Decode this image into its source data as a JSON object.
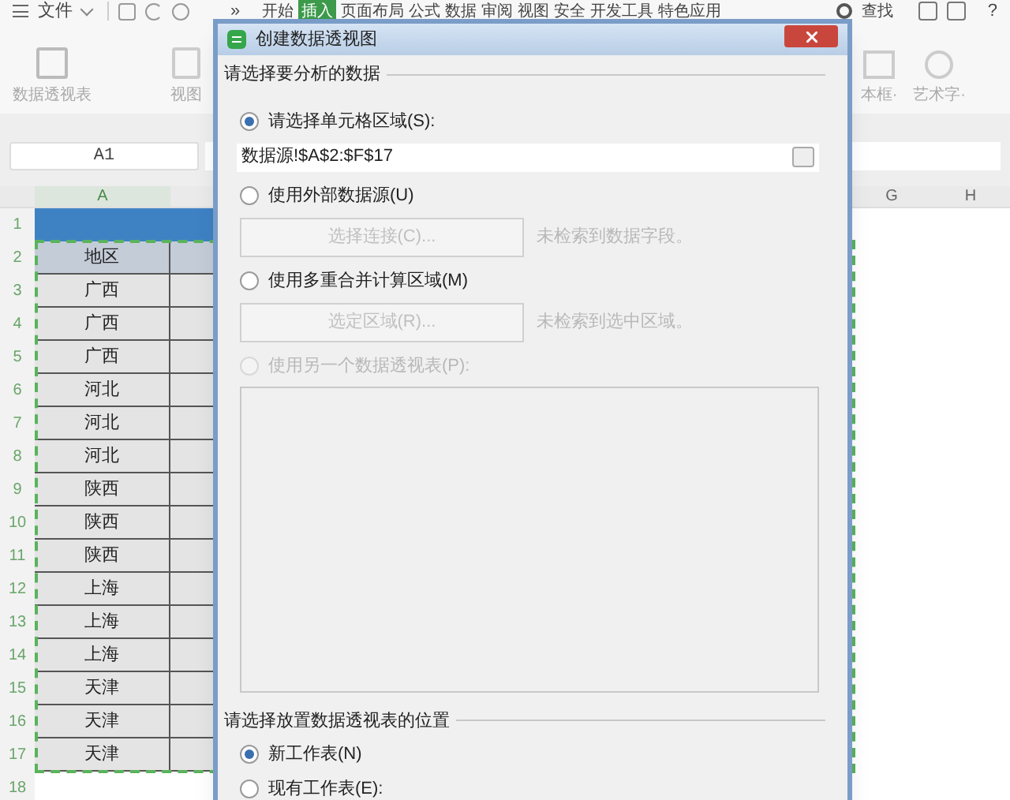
{
  "menu_bar": {
    "file_menu": "文件",
    "more": "»",
    "tabs": [
      {
        "label": "开始",
        "selected": false
      },
      {
        "label": "插入",
        "selected": true
      },
      {
        "label": "页面布局",
        "selected": false
      },
      {
        "label": "公式",
        "selected": false
      },
      {
        "label": "数据",
        "selected": false
      },
      {
        "label": "审阅",
        "selected": false
      },
      {
        "label": "视图",
        "selected": false
      },
      {
        "label": "安全",
        "selected": false
      },
      {
        "label": "开发工具",
        "selected": false
      },
      {
        "label": "特色应用",
        "selected": false
      }
    ],
    "search": "查找",
    "help": "?"
  },
  "ribbon": {
    "left_buttons": [
      "数据透视表",
      "视图"
    ],
    "right_buttons": [
      "本框·",
      "艺术字·"
    ]
  },
  "name_box": "A1",
  "columns": {
    "left": [
      "A"
    ],
    "right": [
      "G",
      "H"
    ]
  },
  "rows": [
    {
      "number": "1",
      "kind": "band"
    },
    {
      "number": "2",
      "kind": "header",
      "value": "地区"
    },
    {
      "number": "3",
      "kind": "data",
      "value": "广西"
    },
    {
      "number": "4",
      "kind": "data",
      "value": "广西"
    },
    {
      "number": "5",
      "kind": "data",
      "value": "广西"
    },
    {
      "number": "6",
      "kind": "data",
      "value": "河北"
    },
    {
      "number": "7",
      "kind": "data",
      "value": "河北"
    },
    {
      "number": "8",
      "kind": "data",
      "value": "河北"
    },
    {
      "number": "9",
      "kind": "data",
      "value": "陕西"
    },
    {
      "number": "10",
      "kind": "data",
      "value": "陕西"
    },
    {
      "number": "11",
      "kind": "data",
      "value": "陕西"
    },
    {
      "number": "12",
      "kind": "data",
      "value": "上海"
    },
    {
      "number": "13",
      "kind": "data",
      "value": "上海"
    },
    {
      "number": "14",
      "kind": "data",
      "value": "上海"
    },
    {
      "number": "15",
      "kind": "data",
      "value": "天津"
    },
    {
      "number": "16",
      "kind": "data",
      "value": "天津"
    },
    {
      "number": "17",
      "kind": "data",
      "value": "天津"
    },
    {
      "number": "18",
      "kind": "empty"
    }
  ],
  "dialog": {
    "title": "创建数据透视图",
    "source_section": "请选择要分析的数据",
    "source_options": [
      {
        "label": "请选择单元格区域(S):",
        "selected": true,
        "disabled": false,
        "field": "数据源!$A$2:$F$17"
      },
      {
        "label": "使用外部数据源(U)",
        "selected": false,
        "disabled": false,
        "button": "选择连接(C)...",
        "note": "未检索到数据字段。"
      },
      {
        "label": "使用多重合并计算区域(M)",
        "selected": false,
        "disabled": false,
        "button": "选定区域(R)...",
        "note": "未检索到选中区域。"
      },
      {
        "label": "使用另一个数据透视表(P):",
        "selected": false,
        "disabled": true,
        "list": true
      }
    ],
    "place_section": "请选择放置数据透视表的位置",
    "place_options": [
      {
        "label": "新工作表(N)",
        "selected": true
      },
      {
        "label": "现有工作表(E):",
        "selected": false
      }
    ]
  }
}
